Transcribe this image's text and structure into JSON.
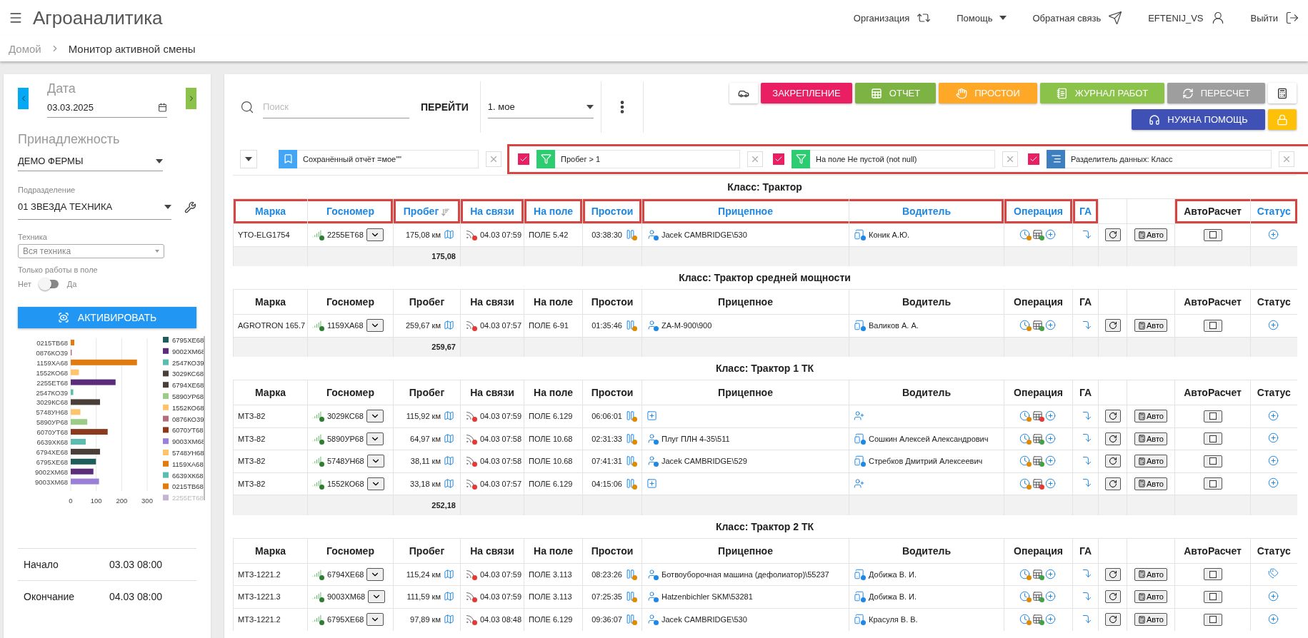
{
  "app": {
    "title": "Агроаналитика",
    "nav": [
      {
        "kind": "org",
        "label": "Организация"
      },
      {
        "kind": "help",
        "label": "Помощь"
      },
      {
        "kind": "feedback",
        "label": "Обратная связь"
      },
      {
        "kind": "user",
        "label": "EFTENIJ_VS"
      },
      {
        "kind": "logout",
        "label": "Выйти"
      }
    ]
  },
  "breadcrumb": [
    "Домой",
    "Монитор активной смены"
  ],
  "sidebar": {
    "date_label": "Дата",
    "date": "03.03.2025",
    "owner_label": "Принадлежность",
    "owner": "ДЕМО ФЕРМЫ",
    "division_label": "Подразделение",
    "division": "01 ЗВЕЗДА ТЕХНИКА",
    "vehicle_label": "Техника",
    "vehicle": "Вся техника",
    "field_only_label": "Только работы в поле",
    "field_only_off": "Нет",
    "field_only_on_label": "Да",
    "field_only": false,
    "activate": "АКТИВИРОВАТЬ",
    "chart_data": {
      "type": "bar",
      "orientation": "horizontal",
      "stacked": true,
      "legend": "right",
      "categories": [
        "0215ТВ68",
        "0876КО39",
        "1159ХА68",
        "1552КО68",
        "2255ЕТ68",
        "2547КО39",
        "3029КС68",
        "5748УН68",
        "5890УР68",
        "6070УТ68",
        "6639ХК68",
        "6794ХЕ68",
        "6795ХЕ68",
        "9002ХМ68",
        "9003ХМ68"
      ],
      "xlim": [
        0,
        300
      ],
      "xticks": [
        0,
        100,
        200,
        300
      ],
      "series": [
        {
          "name": "6795ХЕ68",
          "color": "#1f5c5c",
          "values": [
            null,
            null,
            null,
            null,
            null,
            null,
            null,
            null,
            null,
            null,
            null,
            null,
            99,
            null,
            null
          ]
        },
        {
          "name": "9002ХМ68",
          "color": "#5b2c7a",
          "values": [
            null,
            null,
            null,
            null,
            null,
            null,
            null,
            null,
            null,
            null,
            null,
            null,
            null,
            89,
            null
          ]
        },
        {
          "name": "2547КО39",
          "color": "#5bbcb0",
          "values": [
            null,
            null,
            null,
            null,
            null,
            10,
            null,
            null,
            null,
            null,
            null,
            null,
            null,
            null,
            null
          ]
        },
        {
          "name": "3029КС68",
          "color": "#4a3f38",
          "values": [
            null,
            null,
            null,
            null,
            null,
            null,
            115,
            null,
            null,
            null,
            null,
            null,
            null,
            null,
            null
          ]
        },
        {
          "name": "6794ХЕ68",
          "color": "#4a3f38",
          "values": [
            null,
            null,
            null,
            null,
            null,
            null,
            null,
            null,
            null,
            null,
            null,
            115,
            null,
            null,
            null
          ]
        },
        {
          "name": "5890УР68",
          "color": "#9ccc85",
          "values": [
            null,
            null,
            null,
            null,
            null,
            null,
            null,
            null,
            65,
            null,
            null,
            null,
            null,
            null,
            null
          ]
        },
        {
          "name": "1552КО68",
          "color": "#ffc46b",
          "values": [
            null,
            null,
            null,
            32,
            null,
            null,
            null,
            null,
            null,
            null,
            null,
            null,
            null,
            null,
            null
          ]
        },
        {
          "name": "0876КО39",
          "color": "#b06e7e",
          "values": [
            null,
            4,
            null,
            null,
            null,
            null,
            null,
            null,
            null,
            null,
            null,
            null,
            null,
            null,
            null
          ]
        },
        {
          "name": "6070УТ68",
          "color": "#8b3a1e",
          "values": [
            null,
            null,
            null,
            null,
            null,
            null,
            null,
            null,
            null,
            145,
            null,
            null,
            null,
            null,
            null
          ]
        },
        {
          "name": "9003ХМ68",
          "color": "#9b7fd6",
          "values": [
            null,
            null,
            null,
            null,
            null,
            null,
            null,
            null,
            null,
            null,
            null,
            null,
            null,
            null,
            111
          ]
        },
        {
          "name": "5748УН68",
          "color": "#ffc46b",
          "values": [
            null,
            null,
            null,
            null,
            null,
            null,
            null,
            38,
            null,
            null,
            null,
            null,
            null,
            null,
            null
          ]
        },
        {
          "name": "1159ХА68",
          "color": "#e07b0f",
          "values": [
            null,
            null,
            260,
            null,
            null,
            null,
            null,
            null,
            null,
            null,
            null,
            null,
            null,
            null,
            null
          ]
        },
        {
          "name": "6639ХК68",
          "color": "#5bbcb0",
          "values": [
            null,
            null,
            null,
            null,
            null,
            null,
            null,
            null,
            null,
            null,
            59,
            null,
            null,
            null,
            null
          ]
        },
        {
          "name": "0215ТВ68",
          "color": "#e07b0f",
          "values": [
            14,
            null,
            null,
            null,
            null,
            null,
            null,
            null,
            null,
            null,
            null,
            null,
            null,
            null,
            null
          ]
        },
        {
          "name": "2255ЕТ68",
          "color": "#5b2c7a",
          "values": [
            null,
            null,
            null,
            null,
            176,
            null,
            null,
            null,
            null,
            null,
            null,
            null,
            null,
            null,
            null
          ]
        }
      ]
    },
    "times": [
      {
        "label": "Начало",
        "value": "03.03 08:00"
      },
      {
        "label": "Окончание",
        "value": "04.03 08:00"
      }
    ]
  },
  "toolbar": {
    "search_placeholder": "Поиск",
    "go": "ПЕРЕЙТИ",
    "preset": "1. мое",
    "buttons": [
      [
        {
          "kind": "car"
        },
        {
          "kind": "pin",
          "label": "ЗАКРЕПЛЕНИЕ",
          "color": "#e91e63"
        },
        {
          "kind": "report",
          "label": "ОТЧЕТ",
          "color": "#7cb342"
        },
        {
          "kind": "idle",
          "label": "ПРОСТОИ",
          "color": "#ffa726"
        },
        {
          "kind": "journal",
          "label": "ЖУРНАЛ РАБОТ",
          "color": "#8bc34a"
        },
        {
          "kind": "recalc",
          "label": "ПЕРЕСЧЕТ",
          "color": "#9e9e9e"
        },
        {
          "kind": "calc"
        }
      ],
      [
        {
          "kind": "help",
          "label": "НУЖНА ПОМОЩЬ",
          "color": "#3f51b5"
        },
        {
          "kind": "lock",
          "color": "#ffc107"
        }
      ]
    ]
  },
  "filters": [
    {
      "kind": "saved",
      "label": "Сохранённый отчёт =мое\"\""
    }
  ],
  "highlighted_filters": [
    {
      "kind": "filter",
      "label": "Пробег > 1",
      "checked": true
    },
    {
      "kind": "filter",
      "label": "На поле Не пустой (not null)",
      "checked": true
    },
    {
      "kind": "splitter",
      "label": "Разделитель данных: Класс",
      "checked": true
    }
  ],
  "groups": [
    {
      "title": "Класс: Трактор",
      "columns": [
        {
          "kind": "header",
          "label": "Марка",
          "link": true,
          "framed": true,
          "box_start": true,
          "box_end": false
        },
        {
          "kind": "header",
          "label": "Госномер",
          "link": true,
          "framed": true,
          "box_start": false,
          "box_end": true
        },
        {
          "kind": "header",
          "label": "Пробег",
          "link": true,
          "framed": true,
          "box_start": true,
          "box_end": true,
          "sorted": true
        },
        {
          "kind": "header",
          "label": "На связи",
          "link": true,
          "framed": true,
          "box_start": true,
          "box_end": true
        },
        {
          "kind": "header",
          "label": "На поле",
          "link": true,
          "framed": true,
          "box_start": true,
          "box_end": true
        },
        {
          "kind": "header",
          "label": "Простои",
          "link": true,
          "framed": true,
          "box_start": true,
          "box_end": true
        },
        {
          "kind": "header",
          "label": "Прицепное",
          "link": true,
          "framed": true,
          "box_start": true,
          "box_end": false
        },
        {
          "kind": "header",
          "label": "Водитель",
          "link": true,
          "framed": true,
          "box_start": false,
          "box_end": true
        },
        {
          "kind": "header",
          "label": "Операция",
          "link": true,
          "framed": true,
          "box_start": true,
          "box_end": true
        },
        {
          "kind": "header",
          "label": "ГА",
          "link": true,
          "framed": true,
          "box_start": true,
          "box_end": true
        },
        {
          "kind": "blank"
        },
        {
          "kind": "blank"
        },
        {
          "kind": "header",
          "label": "АвтоРасчет",
          "link": false,
          "framed": true,
          "box_start": true,
          "box_end": false
        },
        {
          "kind": "header",
          "label": "Статус",
          "link": true,
          "framed": true,
          "box_start": false,
          "box_end": true
        }
      ],
      "rows": [
        {
          "brand": "YTO-ELG1754",
          "plate": "2255ЕТ68",
          "mileage": "175,08 км",
          "online": "04.03 07:59",
          "field": "ПОЛЕ 5.42",
          "idle": "03:38:30",
          "trailer": "Jacek CAMBRIDGE\\530",
          "driver": "Коник А.Ю.",
          "operation_ok": true,
          "auto": "Авто",
          "auto_calc": false,
          "tagged": false
        }
      ],
      "total": "175,08"
    },
    {
      "title": "Класс: Трактор средней мощности",
      "columns": [
        {
          "kind": "header",
          "label": "Марка",
          "link": false,
          "framed": false
        },
        {
          "kind": "header",
          "label": "Госномер",
          "link": false,
          "framed": false
        },
        {
          "kind": "header",
          "label": "Пробег",
          "link": false,
          "framed": false
        },
        {
          "kind": "header",
          "label": "На связи",
          "link": false,
          "framed": false
        },
        {
          "kind": "header",
          "label": "На поле",
          "link": false,
          "framed": false
        },
        {
          "kind": "header",
          "label": "Простои",
          "link": false,
          "framed": false
        },
        {
          "kind": "header",
          "label": "Прицепное",
          "link": false,
          "framed": false
        },
        {
          "kind": "header",
          "label": "Водитель",
          "link": false,
          "framed": false
        },
        {
          "kind": "header",
          "label": "Операция",
          "link": false,
          "framed": false
        },
        {
          "kind": "header",
          "label": "ГА",
          "link": false,
          "framed": false
        },
        {
          "kind": "blank"
        },
        {
          "kind": "blank"
        },
        {
          "kind": "header",
          "label": "АвтоРасчет",
          "link": false,
          "framed": false
        },
        {
          "kind": "header",
          "label": "Статус",
          "link": false,
          "framed": false
        }
      ],
      "rows": [
        {
          "brand": "AGROTRON 165.7",
          "plate": "1159ХА68",
          "mileage": "259,67 км",
          "online": "04.03 07:57",
          "field": "ПОЛЕ 6-91",
          "idle": "01:35:46",
          "trailer": "ZA-M-900\\900",
          "driver": "Валиков А. А.",
          "operation_ok": true,
          "auto": "Авто",
          "auto_calc": false,
          "tagged": false
        }
      ],
      "total": "259,67"
    },
    {
      "title": "Класс: Трактор 1 ТК",
      "columns": [
        {
          "kind": "header",
          "label": "Марка",
          "link": false,
          "framed": false
        },
        {
          "kind": "header",
          "label": "Госномер",
          "link": false,
          "framed": false
        },
        {
          "kind": "header",
          "label": "Пробег",
          "link": false,
          "framed": false
        },
        {
          "kind": "header",
          "label": "На связи",
          "link": false,
          "framed": false
        },
        {
          "kind": "header",
          "label": "На поле",
          "link": false,
          "framed": false
        },
        {
          "kind": "header",
          "label": "Простои",
          "link": false,
          "framed": false
        },
        {
          "kind": "header",
          "label": "Прицепное",
          "link": false,
          "framed": false
        },
        {
          "kind": "header",
          "label": "Водитель",
          "link": false,
          "framed": false
        },
        {
          "kind": "header",
          "label": "Операция",
          "link": false,
          "framed": false
        },
        {
          "kind": "header",
          "label": "ГА",
          "link": false,
          "framed": false
        },
        {
          "kind": "blank"
        },
        {
          "kind": "blank"
        },
        {
          "kind": "header",
          "label": "АвтоРасчет",
          "link": false,
          "framed": false
        },
        {
          "kind": "header",
          "label": "Статус",
          "link": false,
          "framed": false
        }
      ],
      "rows": [
        {
          "brand": "МТЗ-82",
          "plate": "3029КС68",
          "mileage": "115,92 км",
          "online": "04.03 07:59",
          "field": "ПОЛЕ 6.129",
          "idle": "06:06:01",
          "operation_ok": false,
          "auto": "Авто",
          "auto_calc": false,
          "tagged": false
        },
        {
          "brand": "МТЗ-82",
          "plate": "5890УР68",
          "mileage": "64,97 км",
          "online": "04.03 07:58",
          "field": "ПОЛЕ 10.68",
          "idle": "02:31:33",
          "trailer": "Плуг ПЛН 4-35\\511",
          "driver": "Сошкин Алексей Александрович",
          "operation_ok": true,
          "auto": "Авто",
          "auto_calc": false,
          "tagged": false
        },
        {
          "brand": "МТЗ-82",
          "plate": "5748УН68",
          "mileage": "38,11 км",
          "online": "04.03 07:58",
          "field": "ПОЛЕ 10.68",
          "idle": "07:41:31",
          "trailer": "Jacek CAMBRIDGE\\529",
          "driver": "Стребков Дмитрий Алексеевич",
          "operation_ok": true,
          "auto": "Авто",
          "auto_calc": false,
          "tagged": false
        },
        {
          "brand": "МТЗ-82",
          "plate": "1552КО68",
          "mileage": "33,18 км",
          "online": "04.03 07:57",
          "field": "ПОЛЕ 6.129",
          "idle": "04:15:06",
          "operation_ok": false,
          "auto": "Авто",
          "auto_calc": false,
          "tagged": false
        }
      ],
      "total": "252,18"
    },
    {
      "title": "Класс: Трактор 2 ТК",
      "columns": [
        {
          "kind": "header",
          "label": "Марка",
          "link": false,
          "framed": false
        },
        {
          "kind": "header",
          "label": "Госномер",
          "link": false,
          "framed": false
        },
        {
          "kind": "header",
          "label": "Пробег",
          "link": false,
          "framed": false
        },
        {
          "kind": "header",
          "label": "На связи",
          "link": false,
          "framed": false
        },
        {
          "kind": "header",
          "label": "На поле",
          "link": false,
          "framed": false
        },
        {
          "kind": "header",
          "label": "Простои",
          "link": false,
          "framed": false
        },
        {
          "kind": "header",
          "label": "Прицепное",
          "link": false,
          "framed": false
        },
        {
          "kind": "header",
          "label": "Водитель",
          "link": false,
          "framed": false
        },
        {
          "kind": "header",
          "label": "Операция",
          "link": false,
          "framed": false
        },
        {
          "kind": "header",
          "label": "ГА",
          "link": false,
          "framed": false
        },
        {
          "kind": "blank"
        },
        {
          "kind": "blank"
        },
        {
          "kind": "header",
          "label": "АвтоРасчет",
          "link": false,
          "framed": false
        },
        {
          "kind": "header",
          "label": "Статус",
          "link": false,
          "framed": false
        }
      ],
      "rows": [
        {
          "brand": "МТЗ-1221.2",
          "plate": "6794ХЕ68",
          "mileage": "115,24 км",
          "online": "04.03 07:59",
          "field": "ПОЛЕ 3.113",
          "idle": "08:23:26",
          "trailer": "Ботвоуборочная машина (дефолиатор)\\55237",
          "driver": "Добижа В. И.",
          "operation_ok": true,
          "auto": "Авто",
          "auto_calc": false,
          "tagged": true
        },
        {
          "brand": "МТЗ-1221.3",
          "plate": "9003ХМ68",
          "mileage": "111,59 км",
          "online": "04.03 07:59",
          "field": "ПОЛЕ 3.113",
          "idle": "07:25:35",
          "trailer": "Hatzenbichler SKM\\53281",
          "driver": "Добижа В. И.",
          "operation_ok": true,
          "auto": "Авто",
          "auto_calc": false,
          "tagged": false
        },
        {
          "brand": "МТЗ-1221.2",
          "plate": "6795ХЕ68",
          "mileage": "97,89 км",
          "online": "04.03 08:48",
          "field": "ПОЛЕ 6.129",
          "idle": "09:36:07",
          "trailer": "Jacek CAMBRIDGE\\530",
          "driver": "Красуля В. В.",
          "operation_ok": true,
          "auto": "Авто",
          "auto_calc": false,
          "tagged": false
        }
      ]
    }
  ]
}
